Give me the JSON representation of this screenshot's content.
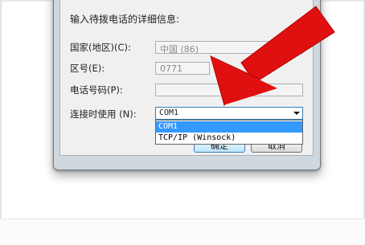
{
  "dialog": {
    "instruction": "输入待拨电话的详细信息:",
    "country_label": "国家(地区)(C):",
    "country_value": "中国 (86)",
    "area_label": "区号(E):",
    "area_value": "0771",
    "phone_label": "电话号码(P):",
    "phone_value": "",
    "connect_label": "连接时使用 (N):",
    "connect_selected": "COM1",
    "connect_options": [
      "COM1",
      "TCP/IP (Winsock)"
    ],
    "ok_label": "确定",
    "cancel_label": "取消"
  },
  "colors": {
    "arrow": "#e01010",
    "selection": "#3399ff"
  }
}
